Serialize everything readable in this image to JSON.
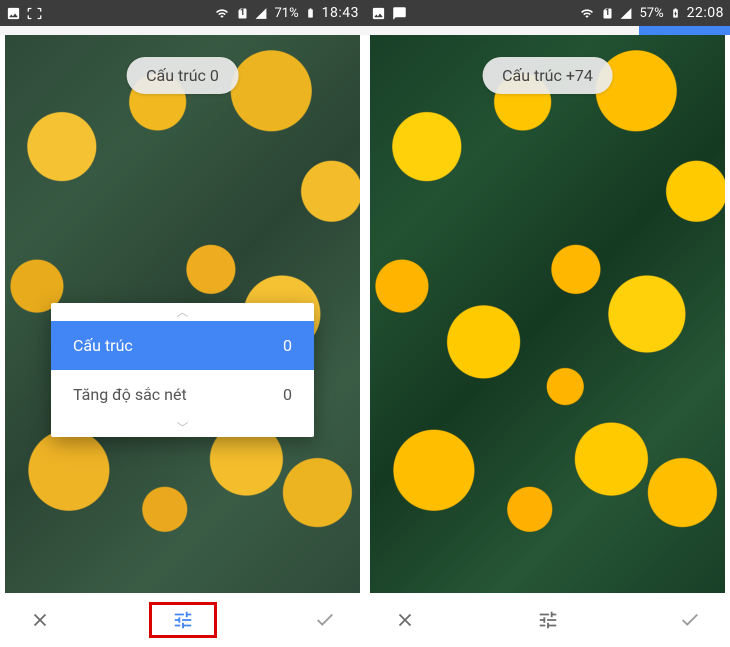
{
  "left": {
    "status": {
      "battery_pct": "71%",
      "time": "18:43",
      "sim_label": "1"
    },
    "pill": "Cấu trúc 0",
    "menu": {
      "items": [
        {
          "label": "Cấu trúc",
          "value": "0",
          "selected": true
        },
        {
          "label": "Tăng độ sắc nét",
          "value": "0",
          "selected": false
        }
      ]
    }
  },
  "right": {
    "status": {
      "battery_pct": "57%",
      "time": "22:08",
      "sim_label": "1"
    },
    "pill": "Cấu trúc +74",
    "tabstrip_blue": {
      "left_pct": 75,
      "width_pct": 25
    }
  },
  "colors": {
    "accent": "#4285f4",
    "highlight_box": "#d90000"
  }
}
